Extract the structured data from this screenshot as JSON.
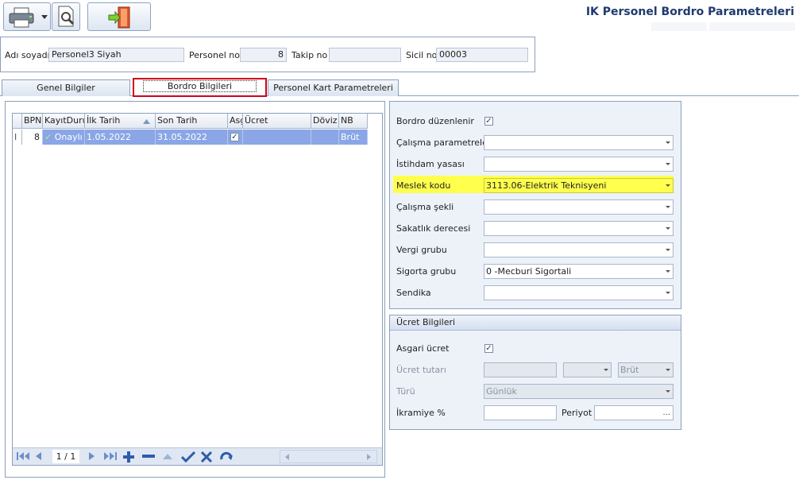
{
  "app": {
    "title": "IK Personel Bordro Parametreleri"
  },
  "header": {
    "ad_soyadi_label": "Adı soyadı",
    "ad_soyadi_value": "Personel3 Siyah",
    "personel_no_label": "Personel no",
    "personel_no_value": "8",
    "takip_no_label": "Takip no",
    "takip_no_value": "",
    "sicil_no_label": "Sicil no",
    "sicil_no_value": "00003"
  },
  "tabs": [
    {
      "label": "Genel Bilgiler",
      "active": false
    },
    {
      "label": "Bordro Bilgileri",
      "active": true
    },
    {
      "label": "Personel Kart Parametreleri",
      "active": false
    }
  ],
  "grid": {
    "columns": [
      "BPN",
      "KayıtDurumu",
      "İlk Tarih",
      "Son Tarih",
      "Asgari",
      "Ücret",
      "Döviz",
      "NB"
    ],
    "rows": [
      {
        "row_indicator": "I",
        "bpn": "8",
        "kayit_durumu": "Onaylı",
        "ilk_tarih": "1.05.2022",
        "son_tarih": "31.05.2022",
        "asgari": true,
        "ucret": "",
        "doviz": "",
        "nb": "Brüt"
      }
    ],
    "navigator": {
      "page": "1 / 1"
    }
  },
  "bordro": {
    "duzenlenir_label": "Bordro düzenlenir",
    "duzenlenir_checked": true,
    "fields": [
      {
        "label": "Çalışma parametreleri",
        "value": ""
      },
      {
        "label": "İstihdam yasası",
        "value": ""
      },
      {
        "label": "Meslek kodu",
        "value": "3113.06-Elektrik Teknisyeni"
      },
      {
        "label": "Çalışma şekli",
        "value": ""
      },
      {
        "label": "Sakatlık derecesi",
        "value": ""
      },
      {
        "label": "Vergi grubu",
        "value": ""
      },
      {
        "label": "Sigorta grubu",
        "value": "0 -Mecburi Sigortali"
      },
      {
        "label": "Sendika",
        "value": ""
      }
    ],
    "highlight_color": "#ffff4d"
  },
  "ucret": {
    "title": "Ücret Bilgileri",
    "asgari_label": "Asgari ücret",
    "asgari_checked": true,
    "tutari_label": "Ücret tutarı",
    "tutari_value": "",
    "doviz_value": "",
    "brut_value": "Brüt",
    "turu_label": "Türü",
    "turu_value": "Günlük",
    "ikramiye_label": "İkramiye %",
    "ikramiye_value": "",
    "periyot_label": "Periyot",
    "periyot_value": "",
    "ellipsis": "..."
  }
}
